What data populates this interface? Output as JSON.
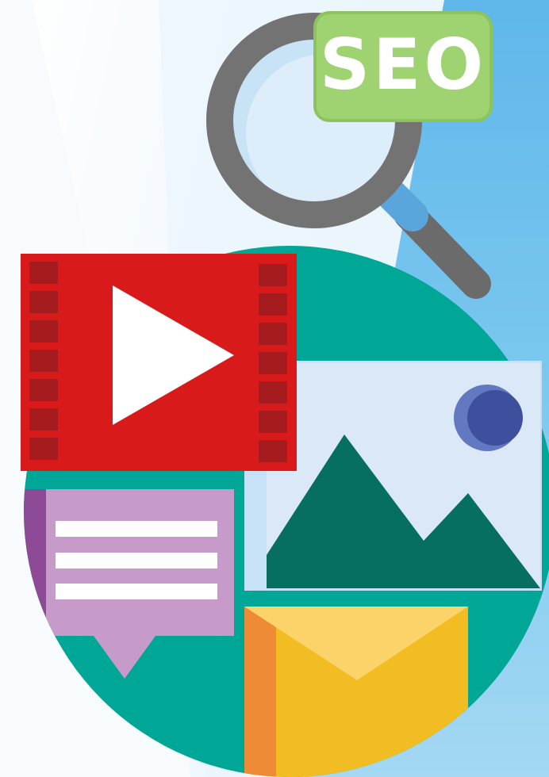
{
  "illustration": {
    "seo_badge": {
      "text": "SEO"
    },
    "icons": [
      "magnifier-icon",
      "video-player-icon",
      "image-icon",
      "chat-bubble-icon",
      "email-envelope-icon"
    ],
    "colors": {
      "background_light": "#eef6fc",
      "background_blue": "#6ec1ec",
      "circle_teal": "#00a696",
      "magnifier_frame": "#737373",
      "magnifier_lens": "#c8e2f6",
      "magnifier_neck": "#5aa5dc",
      "seo_badge_green": "#9fd270",
      "video_red": "#d91a1a",
      "film_holes": "#a61c1e",
      "image_bg": "#dbe8f8",
      "mountain_green": "#076f62",
      "sun_blue": "#3e4f9e",
      "chat_lilac": "#c69ac9",
      "chat_purple": "#8d4a97",
      "envelope_yellow": "#f2bd22",
      "envelope_orange": "#ef8a36"
    }
  }
}
